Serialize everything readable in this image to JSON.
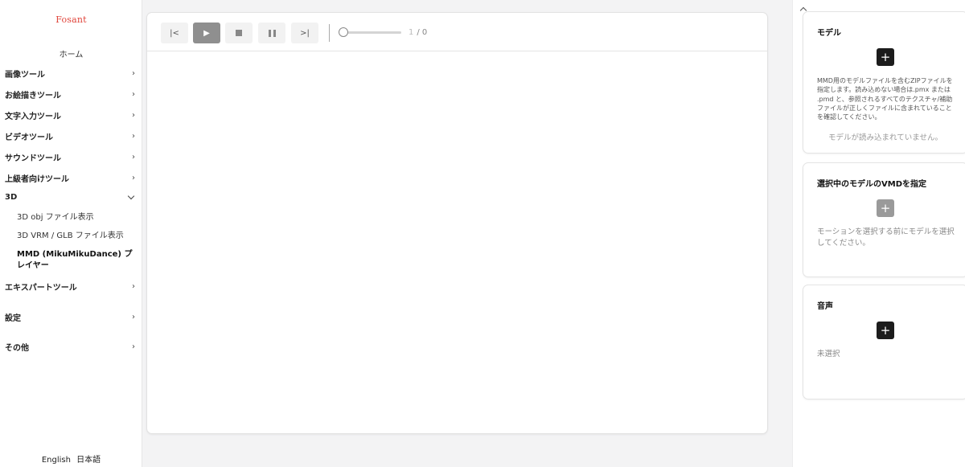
{
  "sidebar": {
    "logo": "Fosant",
    "home": "ホーム",
    "items": [
      {
        "label": "画像ツール"
      },
      {
        "label": "お絵描きツール"
      },
      {
        "label": "文字入力ツール"
      },
      {
        "label": "ビデオツール"
      },
      {
        "label": "サウンドツール"
      },
      {
        "label": "上級者向けツール"
      },
      {
        "label": "3D"
      }
    ],
    "sub_items": [
      {
        "label": "3D obj ファイル表示"
      },
      {
        "label": "3D VRM / GLB ファイル表示"
      },
      {
        "label": "MMD (MikuMikuDance) プレイヤー"
      }
    ],
    "items_after": [
      {
        "label": "エキスパートツール"
      },
      {
        "label": "設定"
      },
      {
        "label": "その他"
      }
    ],
    "languages": [
      "English",
      "日本語"
    ]
  },
  "player": {
    "buttons": {
      "first": "|<",
      "play": "▶",
      "last": ">|"
    },
    "frame_current": "1",
    "frame_total": "/ 0",
    "progress": 0
  },
  "right_panel": {
    "model": {
      "title": "モデル",
      "add": "+",
      "description": "MMD用のモデルファイルを含むZIPファイルを指定します。読み込めない場合は.pmx または .pmd と、参照されるすべてのテクスチャ/補助ファイルが正しくファイルに含まれていることを確認してください。",
      "status": "モデルが読み込まれていません。"
    },
    "motion": {
      "title": "選択中のモデルのVMDを指定",
      "add": "+",
      "description": "モーションを選択する前にモデルを選択してください。"
    },
    "audio": {
      "title": "音声",
      "add": "+",
      "status": "未選択"
    }
  },
  "colors": {
    "logo": "#e0443a",
    "play_button": "#8f8f8f",
    "add_button": "#1c1c1c",
    "add_button_disabled": "#9a9a9a"
  }
}
